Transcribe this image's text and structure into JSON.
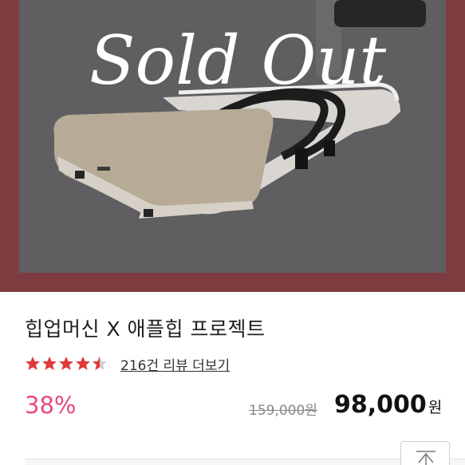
{
  "hero": {
    "overlay_text": "Sold Out",
    "colors": {
      "frame": "#7e3c40",
      "backdrop": "#5f5e60"
    },
    "image_icon": "hip-up-machine-image"
  },
  "product": {
    "title": "힙업머신 X 애플힙 프로젝트",
    "rating": 4.5,
    "rating_max": 5,
    "review_link": "216건 리뷰 더보기",
    "discount": "38%",
    "original_price": "159,000원",
    "sale_price": "98,000",
    "sale_currency": "원"
  },
  "colors": {
    "star": "#e03a3a",
    "discount": "#e64a7d"
  },
  "buttons": {
    "scroll_top_icon": "arrow-up-icon"
  }
}
